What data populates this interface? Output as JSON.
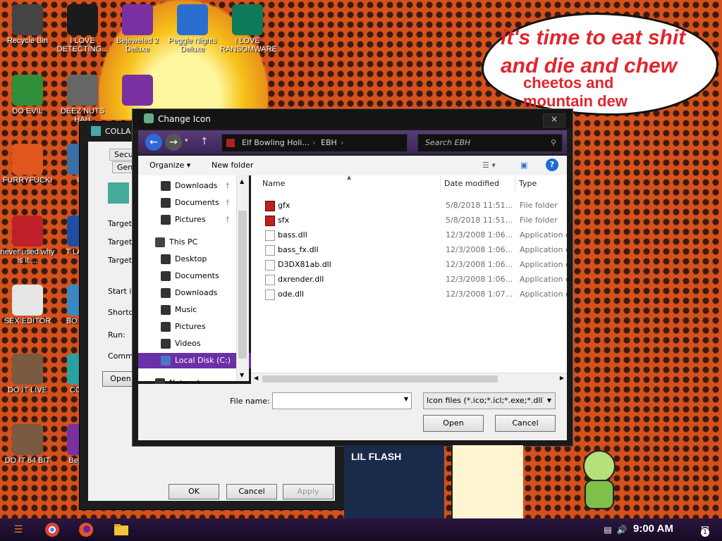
{
  "desktop": {
    "speech_bubble": {
      "line1": "it's time to eat shit",
      "line2": "and die and chew",
      "line3": "cheetos and",
      "line4": "mountain dew"
    },
    "icons": [
      {
        "label": "Recycle Bin",
        "icon": "recycle-bin-icon",
        "color": "#444444"
      },
      {
        "label": "I LOVE DETECTING...",
        "icon": "de-app-icon",
        "color": "#1b1b1b"
      },
      {
        "label": "Bejeweled 2 Deluxe",
        "icon": "bejeweled-icon",
        "color": "#7a30a0"
      },
      {
        "label": "Peggle Nights Deluxe",
        "icon": "peggle-icon",
        "color": "#2a6fd0"
      },
      {
        "label": "I LOVE RANSOMWARE",
        "icon": "publisher-icon",
        "color": "#0e7a5a"
      },
      {
        "label": "DO EVIL",
        "icon": "chrome-icon",
        "color": "#2f8f3a"
      },
      {
        "label": "DEEZ NUTS HAH",
        "icon": "window-stack-icon",
        "color": "#666666"
      },
      {
        "label": "Be",
        "icon": "bejeweled-icon",
        "color": "#7a30a0"
      },
      {
        "label": "FURRYFUCK!",
        "icon": "firefox-icon",
        "color": "#e0561f"
      },
      {
        "label": "ILL",
        "icon": "app-icon",
        "color": "#3b6ea5"
      },
      {
        "label": "never used why is it ...",
        "icon": "dev-cpp-icon",
        "color": "#c0202a"
      },
      {
        "label": "T LANGU",
        "icon": "app-icon",
        "color": "#1f4fa0"
      },
      {
        "label": "SEX EDITOR",
        "icon": "hxd-icon",
        "color": "#e6e6e6"
      },
      {
        "label": "BO SIMU",
        "icon": "app-icon",
        "color": "#3a88c0"
      },
      {
        "label": "DO IT LIVE",
        "icon": "portrait-icon",
        "color": "#7a5a40"
      },
      {
        "label": "COLLA",
        "icon": "app-icon",
        "color": "#2aa0a0"
      },
      {
        "label": "DO IT 64 BIT",
        "icon": "portrait-64-icon",
        "color": "#7a5a40"
      },
      {
        "label": "Beje De",
        "icon": "bejeweled-icon",
        "color": "#7a30a0"
      }
    ]
  },
  "props_window": {
    "title": "COLLA",
    "tabs": [
      "Securi",
      "Gene"
    ],
    "labels": {
      "target_type": "Target ty",
      "target_location": "Target lo",
      "target": "Target:",
      "start_in": "Start in:",
      "shortcut": "Shortcut",
      "run": "Run:",
      "comment": "Commen"
    },
    "open_button": "Open",
    "ok": "OK",
    "cancel": "Cancel",
    "apply": "Apply"
  },
  "dialog": {
    "title": "Change Icon",
    "close": "×",
    "breadcrumb": [
      "Elf Bowling Holi...",
      "EBH"
    ],
    "search_placeholder": "Search EBH",
    "toolbar": {
      "organize": "Organize ▾",
      "new_folder": "New folder"
    },
    "nav": [
      {
        "label": "Downloads",
        "pinned": true,
        "color": "#333333"
      },
      {
        "label": "Documents",
        "pinned": true,
        "color": "#333333"
      },
      {
        "label": "Pictures",
        "pinned": true,
        "color": "#333333"
      },
      {
        "label": "This PC",
        "pinned": false,
        "color": "#444444"
      },
      {
        "label": "Desktop",
        "pinned": false,
        "color": "#333333"
      },
      {
        "label": "Documents",
        "pinned": false,
        "color": "#333333"
      },
      {
        "label": "Downloads",
        "pinned": false,
        "color": "#333333"
      },
      {
        "label": "Music",
        "pinned": false,
        "color": "#333333"
      },
      {
        "label": "Pictures",
        "pinned": false,
        "color": "#333333"
      },
      {
        "label": "Videos",
        "pinned": false,
        "color": "#333333"
      },
      {
        "label": "Local Disk (C:)",
        "pinned": false,
        "color": "#4a78c0",
        "selected": true
      },
      {
        "label": "Network",
        "pinned": false,
        "color": "#333333"
      }
    ],
    "columns": {
      "name": "Name",
      "date": "Date modified",
      "type": "Type"
    },
    "files": [
      {
        "name": "gfx",
        "date": "5/8/2018 11:51...",
        "type": "File folder",
        "folder": true
      },
      {
        "name": "sfx",
        "date": "5/8/2018 11:51...",
        "type": "File folder",
        "folder": true
      },
      {
        "name": "bass.dll",
        "date": "12/3/2008 1:06...",
        "type": "Application ext",
        "folder": false
      },
      {
        "name": "bass_fx.dll",
        "date": "12/3/2008 1:06...",
        "type": "Application ext",
        "folder": false
      },
      {
        "name": "D3DX81ab.dll",
        "date": "12/3/2008 1:06...",
        "type": "Application ext",
        "folder": false
      },
      {
        "name": "dxrender.dll",
        "date": "12/3/2008 1:06...",
        "type": "Application ext",
        "folder": false
      },
      {
        "name": "ode.dll",
        "date": "12/3/2008 1:07...",
        "type": "Application ext",
        "folder": false
      }
    ],
    "file_name_label": "File name:",
    "file_name_value": "",
    "filter": "Icon files (*.ico;*.icl;*.exe;*.dll)",
    "open": "Open",
    "cancel": "Cancel"
  },
  "decor": {
    "lil_flash": "LIL FLASH"
  },
  "taskbar": {
    "clock": "9:00 AM",
    "notification_count": "1"
  }
}
